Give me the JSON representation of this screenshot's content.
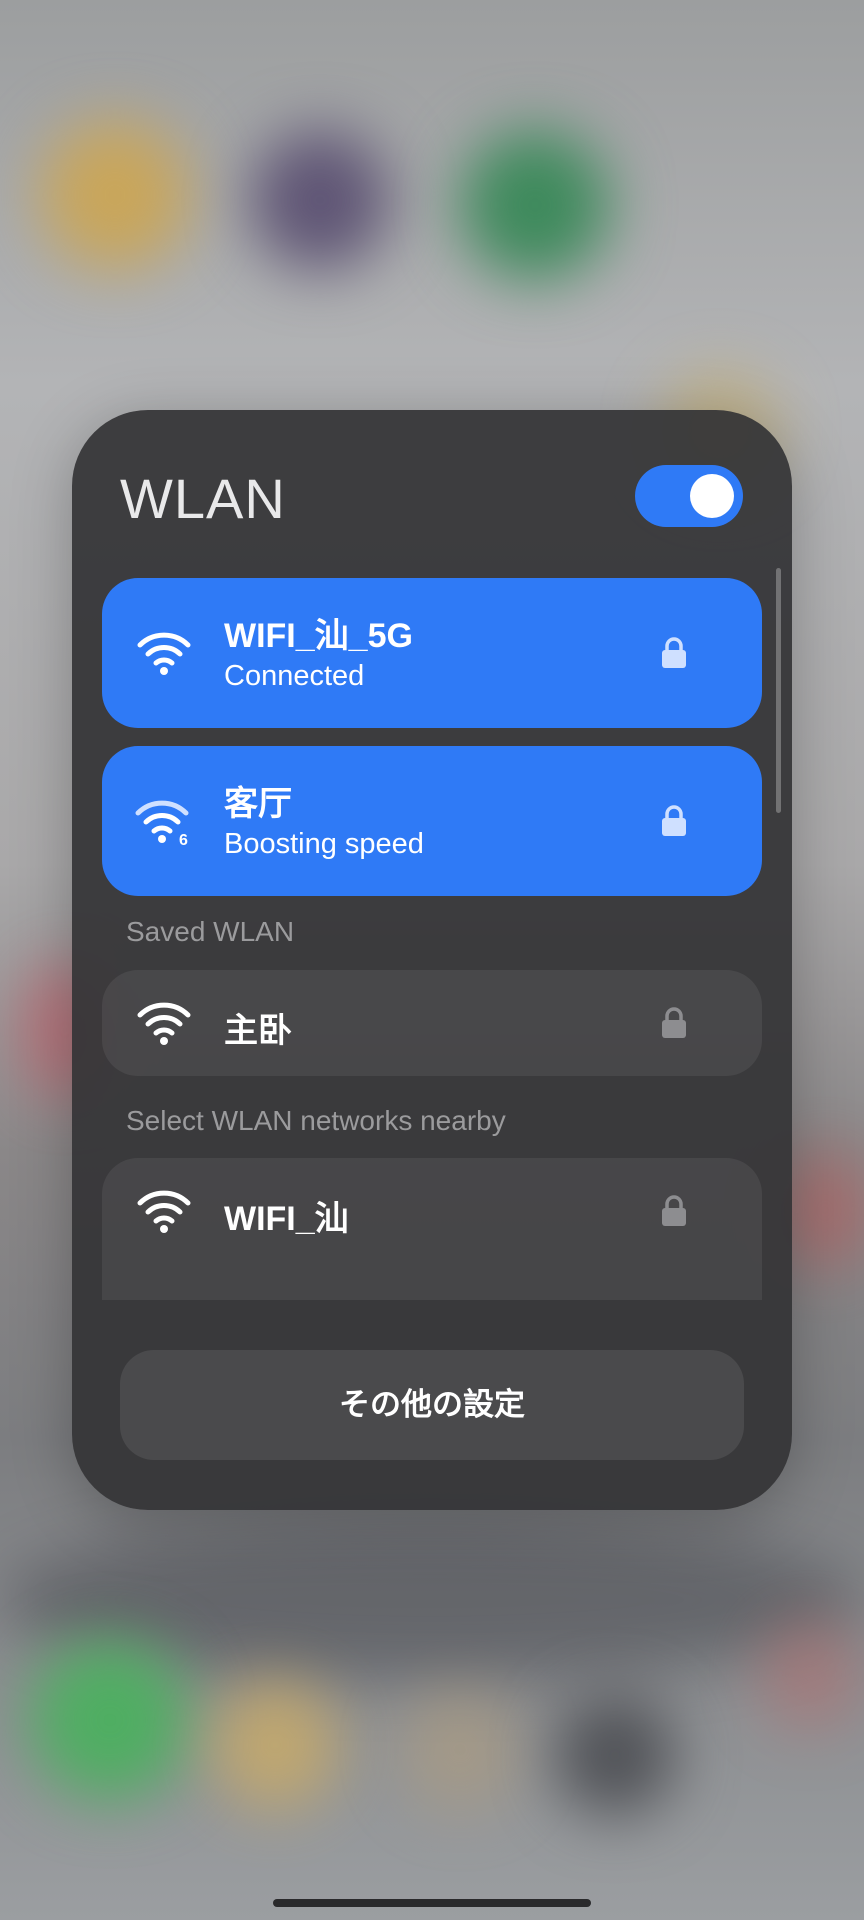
{
  "panel": {
    "title": "WLAN",
    "toggle": {
      "on": true,
      "accent": "#2f7af6"
    }
  },
  "connected": [
    {
      "name": "WIFI_汕_5G",
      "status": "Connected",
      "icon": "wifi-icon",
      "secured": true
    },
    {
      "name": "客厅",
      "status": "Boosting speed",
      "icon": "wifi-6-icon",
      "secured": true
    }
  ],
  "saved": {
    "header": "Saved WLAN",
    "items": [
      {
        "name": "主卧",
        "icon": "wifi-icon",
        "secured": true
      }
    ]
  },
  "nearby": {
    "header": "Select WLAN networks nearby",
    "items": [
      {
        "name": "WIFI_汕",
        "icon": "wifi-icon",
        "secured": true
      }
    ]
  },
  "footer": {
    "more_settings_label": "その他の設定"
  }
}
